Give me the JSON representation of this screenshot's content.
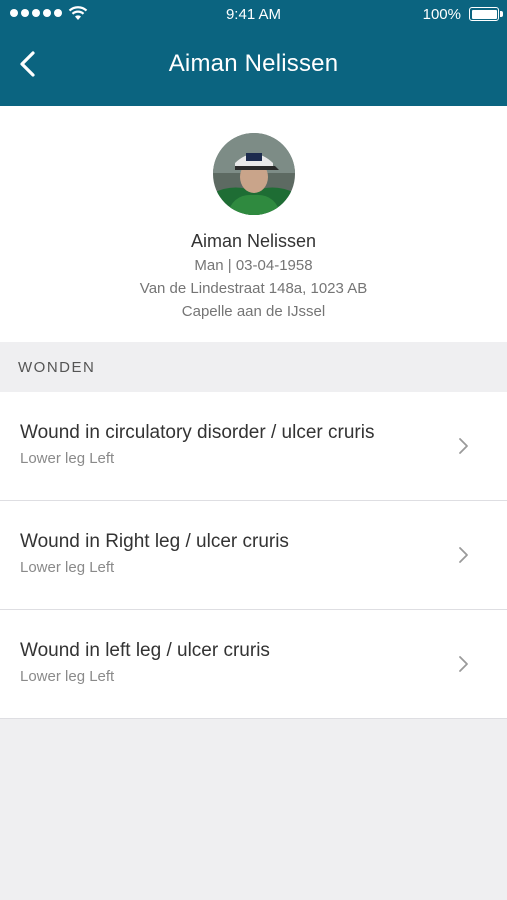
{
  "status_bar": {
    "time": "9:41 AM",
    "battery": "100%"
  },
  "nav": {
    "title": "Aiman Nelissen",
    "back_icon": "chevron-left-icon"
  },
  "profile": {
    "name": "Aiman Nelissen",
    "gender_dob": "Man | 03-04-1958",
    "address": "Van de Lindestraat 148a, 1023 AB",
    "city": "Capelle aan de IJssel"
  },
  "section": {
    "title": "WONDEN"
  },
  "wounds": [
    {
      "title": "Wound in circulatory disorder / ulcer cruris",
      "location": "Lower leg Left"
    },
    {
      "title": "Wound in Right leg / ulcer cruris",
      "location": "Lower leg Left"
    },
    {
      "title": "Wound in left leg / ulcer cruris",
      "location": "Lower leg Left"
    }
  ],
  "colors": {
    "header": "#0b6480",
    "background": "#efeff1"
  }
}
